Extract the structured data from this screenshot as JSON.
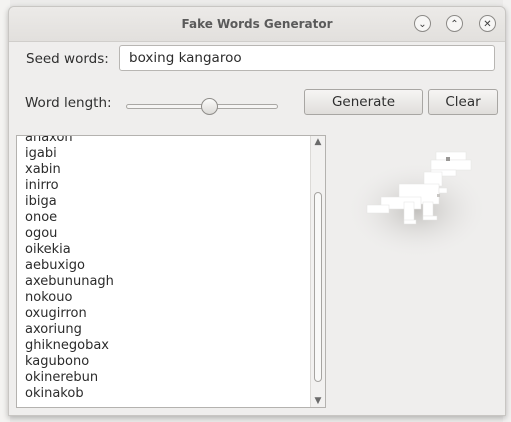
{
  "window": {
    "title": "Fake Words Generator"
  },
  "window_controls": {
    "minimize": "⌄",
    "maximize": "⌃",
    "close": "✕"
  },
  "seed": {
    "label": "Seed words:",
    "value": "boxing kangaroo"
  },
  "word_length": {
    "label": "Word length:",
    "level": 0.55
  },
  "buttons": {
    "generate": "Generate",
    "clear": "Clear"
  },
  "words": [
    "anaxon",
    "igabi",
    "xabin",
    "inirro",
    "ibiga",
    "onoe",
    "ogou",
    "oikekia",
    "aebuxigo",
    "axebununagh",
    "nokouo",
    "oxugirron",
    "axoriung",
    "ghiknegobax",
    "kagubono",
    "okinerebun",
    "okinakob"
  ],
  "scrollbar": {
    "up": "▲",
    "down": "▼"
  },
  "icons": {
    "mascot": "dinosaur-icon"
  }
}
